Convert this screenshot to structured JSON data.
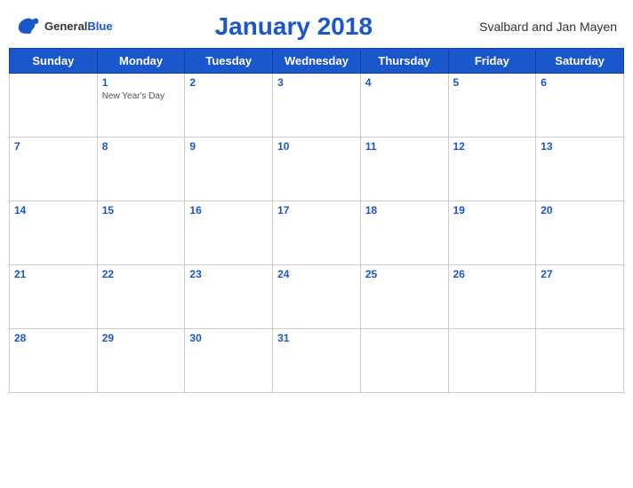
{
  "header": {
    "logo": {
      "general": "General",
      "blue": "Blue"
    },
    "title": "January 2018",
    "region": "Svalbard and Jan Mayen"
  },
  "weekdays": [
    "Sunday",
    "Monday",
    "Tuesday",
    "Wednesday",
    "Thursday",
    "Friday",
    "Saturday"
  ],
  "weeks": [
    [
      {
        "day": null,
        "holiday": null
      },
      {
        "day": 1,
        "holiday": "New Year's Day"
      },
      {
        "day": 2,
        "holiday": null
      },
      {
        "day": 3,
        "holiday": null
      },
      {
        "day": 4,
        "holiday": null
      },
      {
        "day": 5,
        "holiday": null
      },
      {
        "day": 6,
        "holiday": null
      }
    ],
    [
      {
        "day": 7,
        "holiday": null
      },
      {
        "day": 8,
        "holiday": null
      },
      {
        "day": 9,
        "holiday": null
      },
      {
        "day": 10,
        "holiday": null
      },
      {
        "day": 11,
        "holiday": null
      },
      {
        "day": 12,
        "holiday": null
      },
      {
        "day": 13,
        "holiday": null
      }
    ],
    [
      {
        "day": 14,
        "holiday": null
      },
      {
        "day": 15,
        "holiday": null
      },
      {
        "day": 16,
        "holiday": null
      },
      {
        "day": 17,
        "holiday": null
      },
      {
        "day": 18,
        "holiday": null
      },
      {
        "day": 19,
        "holiday": null
      },
      {
        "day": 20,
        "holiday": null
      }
    ],
    [
      {
        "day": 21,
        "holiday": null
      },
      {
        "day": 22,
        "holiday": null
      },
      {
        "day": 23,
        "holiday": null
      },
      {
        "day": 24,
        "holiday": null
      },
      {
        "day": 25,
        "holiday": null
      },
      {
        "day": 26,
        "holiday": null
      },
      {
        "day": 27,
        "holiday": null
      }
    ],
    [
      {
        "day": 28,
        "holiday": null
      },
      {
        "day": 29,
        "holiday": null
      },
      {
        "day": 30,
        "holiday": null
      },
      {
        "day": 31,
        "holiday": null
      },
      {
        "day": null,
        "holiday": null
      },
      {
        "day": null,
        "holiday": null
      },
      {
        "day": null,
        "holiday": null
      }
    ]
  ]
}
